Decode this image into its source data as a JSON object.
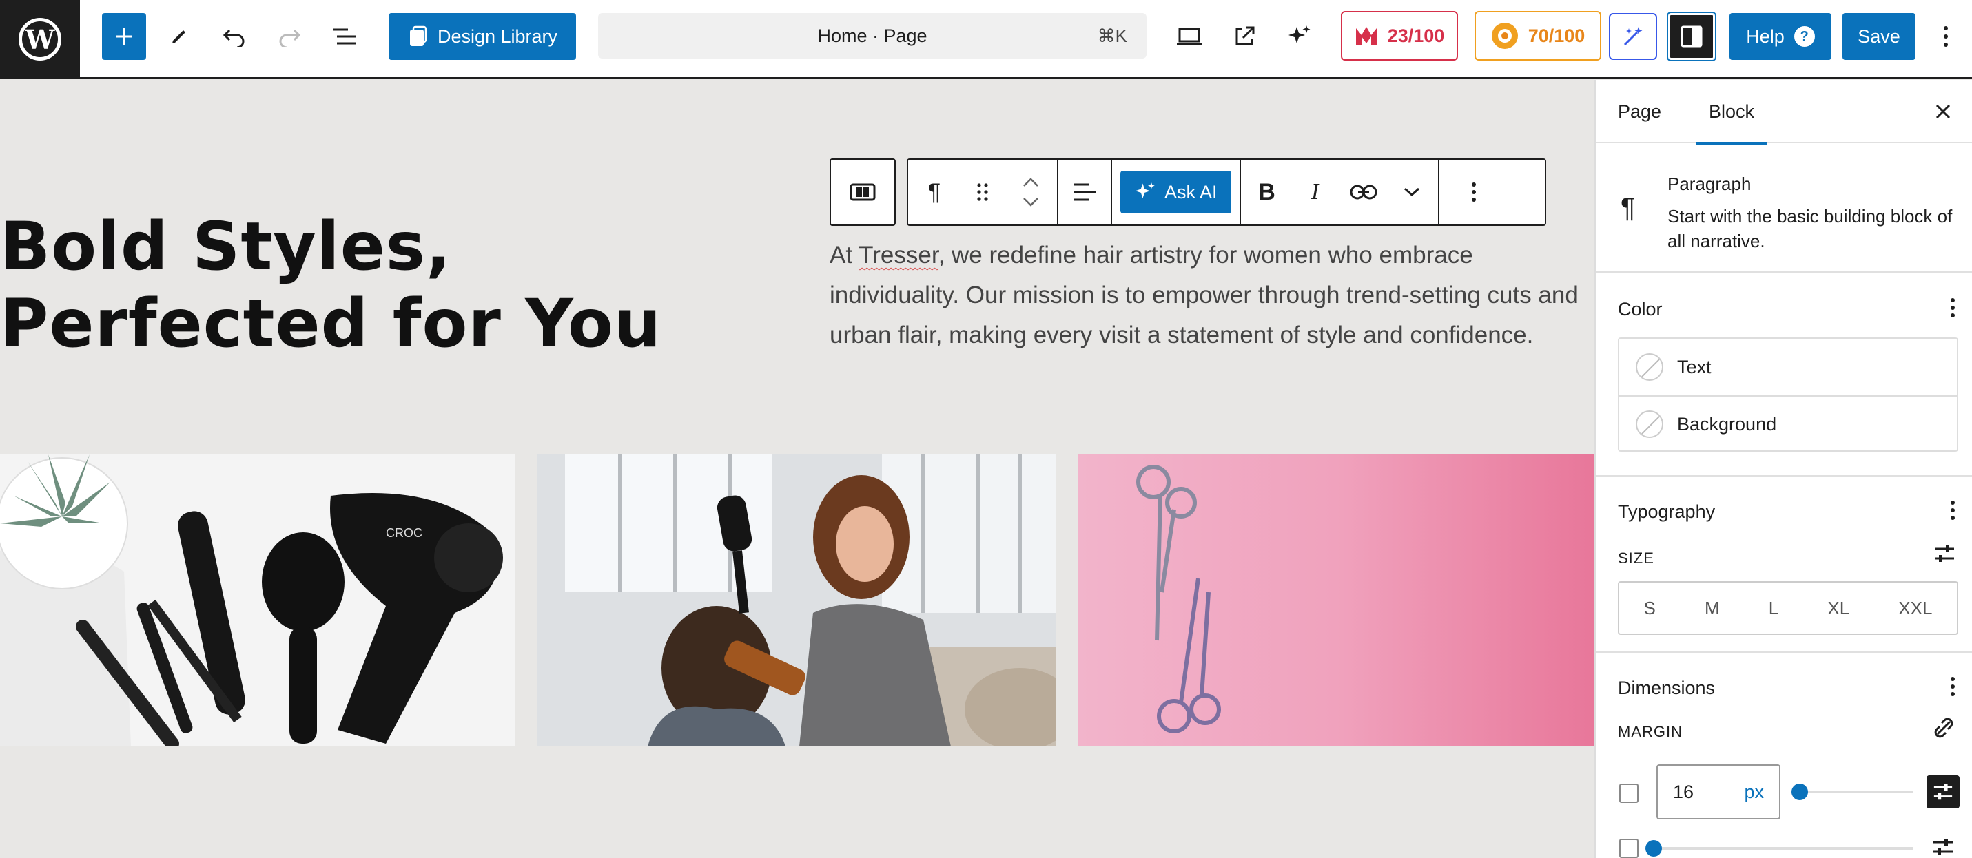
{
  "topbar": {
    "design_library_label": "Design Library",
    "command_title": "Home · Page",
    "command_shortcut": "⌘K",
    "seo_score": "23/100",
    "readability_score": "70/100",
    "help_label": "Help",
    "save_label": "Save"
  },
  "canvas": {
    "hero_title": "Bold Styles, Perfected for You",
    "hero_text_prefix": "At ",
    "hero_text_brand": "Tresser",
    "hero_text_rest": ", we redefine hair artistry for women who embrace individuality. Our mission is to empower through trend-setting cuts and urban flair, making every visit a statement of style and confidence.",
    "ask_ai_label": "Ask AI"
  },
  "sidebar": {
    "tabs": [
      {
        "label": "Page"
      },
      {
        "label": "Block"
      }
    ],
    "active_tab": "Block",
    "block": {
      "name": "Paragraph",
      "description": "Start with the basic building block of all narrative."
    },
    "color": {
      "title": "Color",
      "items": [
        {
          "label": "Text"
        },
        {
          "label": "Background"
        }
      ]
    },
    "typography": {
      "title": "Typography",
      "size_label": "SIZE",
      "sizes": [
        "S",
        "M",
        "L",
        "XL",
        "XXL"
      ]
    },
    "dimensions": {
      "title": "Dimensions",
      "margin_label": "MARGIN",
      "margin_value": "16",
      "margin_unit": "px"
    }
  },
  "colors": {
    "accent": "#0a72bb",
    "seo_red": "#d6304a",
    "readability_orange": "#e8861a",
    "ai_purple": "#3858e9",
    "canvas_bg": "#e8e7e5"
  }
}
